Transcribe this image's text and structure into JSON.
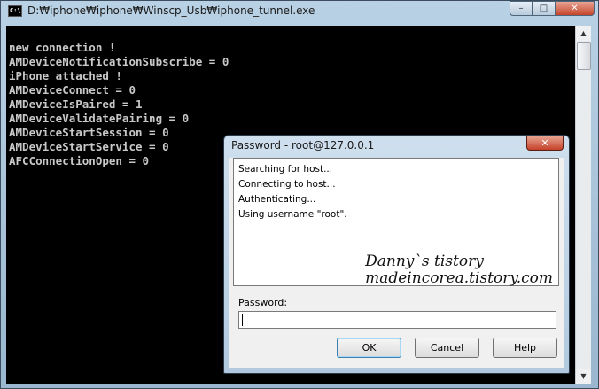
{
  "console": {
    "title": "D:₩iphone₩iphone₩Winscp_Usb₩iphone_tunnel.exe",
    "icon_text": "C:\\",
    "caption_buttons": {
      "minimize": "–",
      "maximize": "□",
      "close": "✕"
    },
    "lines": [
      "new connection !",
      "AMDeviceNotificationSubscribe = 0",
      "iPhone attached !",
      "AMDeviceConnect = 0",
      "AMDeviceIsPaired = 1",
      "AMDeviceValidatePairing = 0",
      "AMDeviceStartSession = 0",
      "AMDeviceStartService = 0",
      "AFCConnectionOpen = 0"
    ],
    "scrollbar": {
      "up_arrow": "▲",
      "down_arrow": "▼"
    }
  },
  "dialog": {
    "title": "Password - root@127.0.0.1",
    "close_glyph": "✕",
    "log": [
      "Searching for host...",
      "Connecting to host...",
      "Authenticating...",
      "Using username \"root\"."
    ],
    "watermark": {
      "line1": "Danny`s tistory",
      "line2": "madeincorea.tistory.com"
    },
    "password_label_first": "P",
    "password_label_rest": "assword:",
    "password_value": "",
    "buttons": {
      "ok": "OK",
      "cancel": "Cancel",
      "help": "Help"
    }
  },
  "colors": {
    "console_bg": "#000000",
    "console_text": "#c8c8c8",
    "close_red": "#c5422a",
    "frame_blue": "#b9d1e4"
  }
}
